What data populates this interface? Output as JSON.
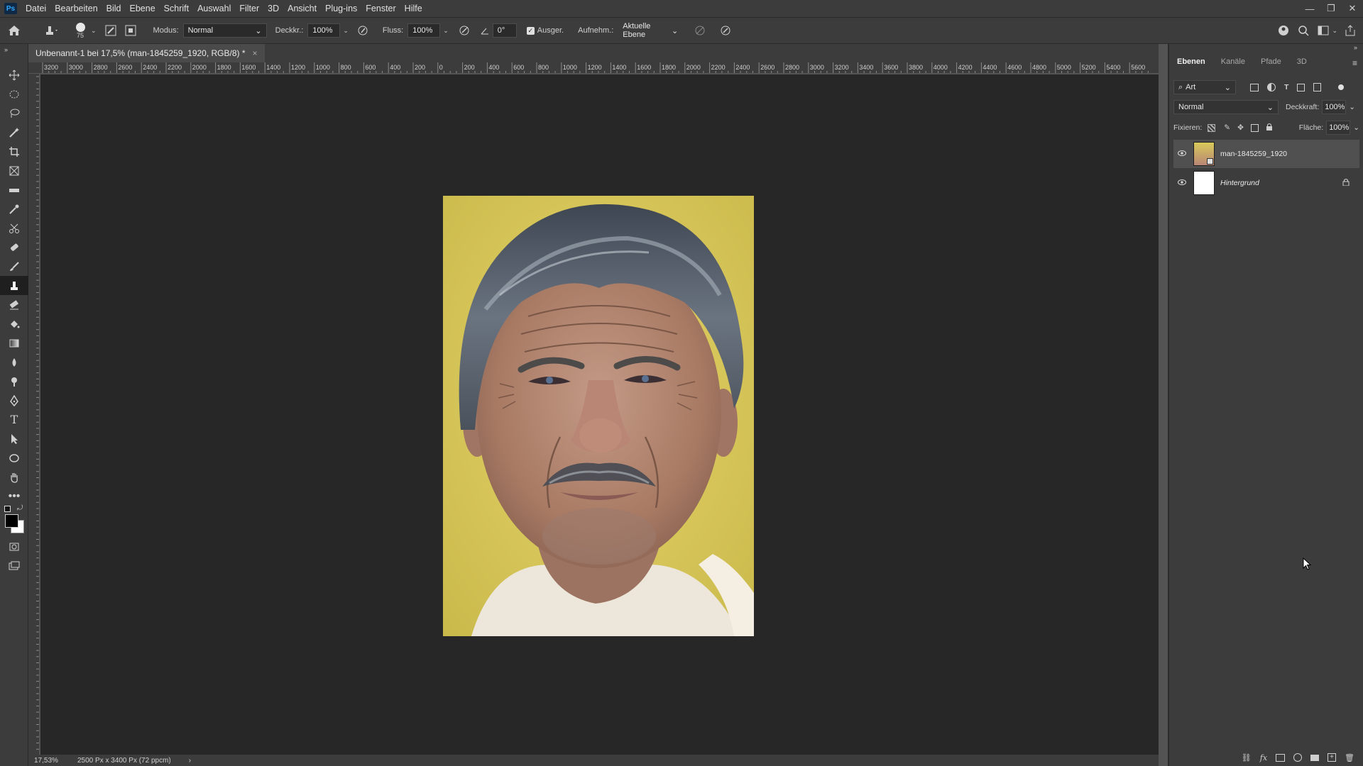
{
  "app": {
    "logo": "Ps"
  },
  "menu": [
    "Datei",
    "Bearbeiten",
    "Bild",
    "Ebene",
    "Schrift",
    "Auswahl",
    "Filter",
    "3D",
    "Ansicht",
    "Plug-ins",
    "Fenster",
    "Hilfe"
  ],
  "window_controls": {
    "minimize": "—",
    "restore": "❐",
    "close": "✕"
  },
  "options": {
    "brush_size": "75",
    "modus_label": "Modus:",
    "modus_value": "Normal",
    "deckkraft_label": "Deckkr.:",
    "deckkraft_value": "100%",
    "fluss_label": "Fluss:",
    "fluss_value": "100%",
    "angle_value": "0°",
    "ausgerichtet_label": "Ausger.",
    "aufnehmen_label": "Aufnehm.:",
    "aufnehmen_value": "Aktuelle Ebene"
  },
  "document": {
    "tab_title": "Unbenannt-1 bei 17,5% (man-1845259_1920, RGB/8) *",
    "tab_close": "×"
  },
  "ruler_top_labels": [
    "3200",
    "3000",
    "2800",
    "2600",
    "2400",
    "2200",
    "2000",
    "1800",
    "1600",
    "1400",
    "1200",
    "1000",
    "800",
    "600",
    "400",
    "200",
    "0",
    "200",
    "400",
    "600",
    "800",
    "1000",
    "1200",
    "1400",
    "1600",
    "1800",
    "2000",
    "2200",
    "2400",
    "2600",
    "2800",
    "3000",
    "3200",
    "3400",
    "3600",
    "3800",
    "4000",
    "4200",
    "4400",
    "4600",
    "4800",
    "5000",
    "5200",
    "5400",
    "5600"
  ],
  "status": {
    "zoom": "17,53%",
    "doc_info": "2500 Px x 3400 Px (72 ppcm)",
    "arrow": "›"
  },
  "panel": {
    "tabs": [
      "Ebenen",
      "Kanäle",
      "Pfade",
      "3D"
    ],
    "active_tab": "Ebenen",
    "filter_kind": "Art",
    "blend_mode": "Normal",
    "opacity_label": "Deckkraft:",
    "opacity_value": "100%",
    "lock_label": "Fixieren:",
    "fill_label": "Fläche:",
    "fill_value": "100%",
    "layers": [
      {
        "name": "man-1845259_1920",
        "visible": true,
        "selected": true,
        "locked": false
      },
      {
        "name": "Hintergrund",
        "visible": true,
        "selected": false,
        "locked": true
      }
    ]
  },
  "colors": {
    "ui_dark": "#3c3c3c",
    "canvas_bg": "#272727",
    "photo_bg": "#d9c95a",
    "accent": "#31a8ff"
  }
}
